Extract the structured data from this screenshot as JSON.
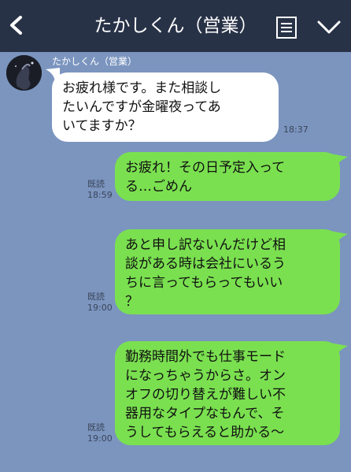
{
  "header": {
    "title": "たかしくん（営業）"
  },
  "sender_name": "たかしくん（営業）",
  "messages": [
    {
      "direction": "in",
      "lines": [
        "お疲れ様です。また相談し",
        "たいんですが金曜夜ってあ",
        "いてますか？"
      ],
      "time": "18:37"
    },
    {
      "direction": "out",
      "lines": [
        "お疲れ！その日予定入って",
        "る…ごめん"
      ],
      "read": "既読",
      "time": "18:59"
    },
    {
      "direction": "out",
      "lines": [
        "あと申し訳ないんだけど相",
        "談がある時は会社にいるう",
        "ちに言ってもらってもいい",
        "？"
      ],
      "read": "既読",
      "time": "19:00"
    },
    {
      "direction": "out",
      "lines": [
        "勤務時間外でも仕事モード",
        "になっちゃうからさ。オン",
        "オフの切り替えが難しい不",
        "器用なタイプなもんで、そ",
        "うしてもらえると助かる～"
      ],
      "read": "既読",
      "time": "19:00"
    }
  ],
  "colors": {
    "header_bg": "#283247",
    "chat_bg": "#7b95bf",
    "incoming_bubble": "#ffffff",
    "outgoing_bubble": "#7ae050"
  },
  "icons": [
    "back-arrow-icon",
    "menu-icon",
    "chevron-down-icon"
  ]
}
